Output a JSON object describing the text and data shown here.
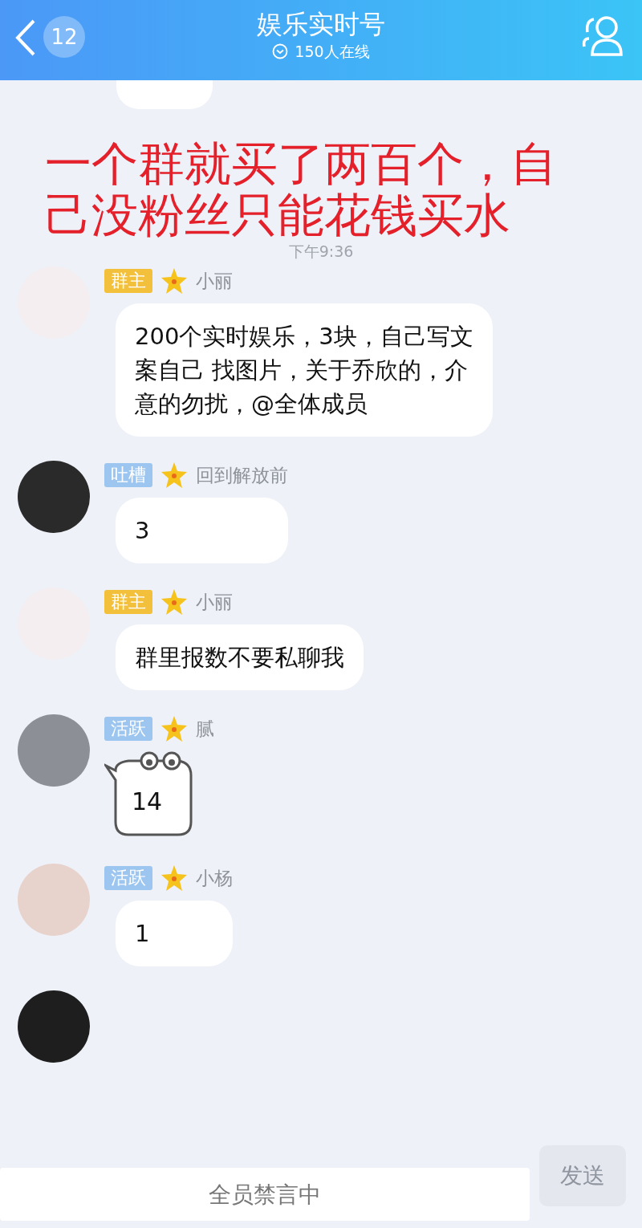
{
  "header": {
    "unread_count": "12",
    "title": "娱乐实时号",
    "subtitle": "150人在线"
  },
  "annotation": {
    "lines": [
      "一个群就买了两百个，自",
      "己没粉丝只能花钱买水"
    ]
  },
  "timestamp": "下午9:36",
  "messages": [
    {
      "kind": "text",
      "badge": "群主",
      "color": "#f3c03c",
      "name": "小丽",
      "text": "200个实时娱乐，3块，自己写文案自己  找图片，关于乔欣的，介意的勿扰，@全体成员"
    },
    {
      "kind": "text",
      "badge": "吐槽",
      "color": "#9cc6f0",
      "name": "回到解放前",
      "text": "3"
    },
    {
      "kind": "text",
      "badge": "群主",
      "color": "#f3c03c",
      "name": "小丽",
      "text": "群里报数不要私聊我"
    },
    {
      "kind": "sticker",
      "badge": "活跃",
      "color": "#9cc6f0",
      "name": "腻",
      "text": "14"
    },
    {
      "kind": "text",
      "badge": "活跃",
      "color": "#9cc6f0",
      "name": "小杨",
      "text": "1"
    }
  ],
  "composer": {
    "placeholder": "全员禁言中",
    "send_label": "发送",
    "disabled": true
  }
}
